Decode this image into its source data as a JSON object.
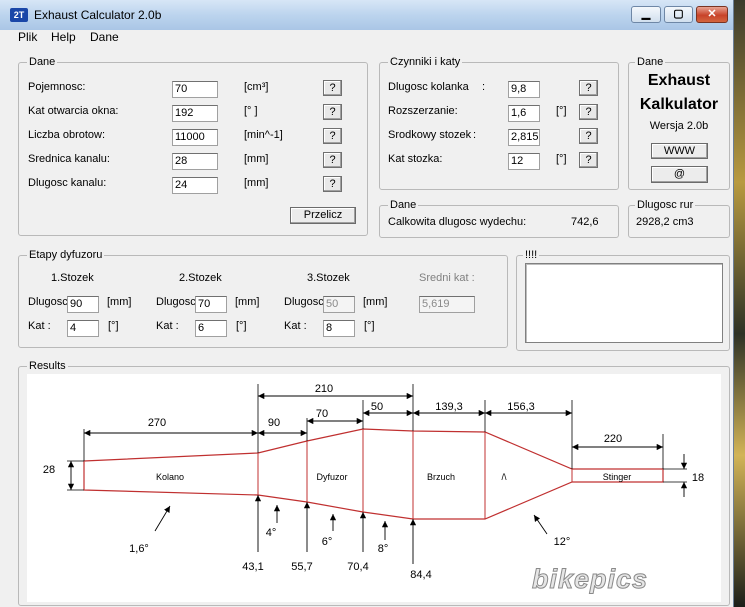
{
  "window": {
    "title": "Exhaust Calculator 2.0b",
    "icon_text": "2T",
    "controls": {
      "minimize": "▁",
      "maximize": "▢",
      "close": "✕"
    }
  },
  "menu": {
    "items": [
      "Plik",
      "Help",
      "Dane"
    ]
  },
  "dane": {
    "legend": "Dane",
    "rows": [
      {
        "label": "Pojemnosc:",
        "value": "70",
        "unit": "[cm³]",
        "help": "?"
      },
      {
        "label": "Kat otwarcia okna:",
        "value": "192",
        "unit": "[° ]",
        "help": "?"
      },
      {
        "label": "Liczba obrotow:",
        "value": "11000",
        "unit": "[min^-1]",
        "help": "?"
      },
      {
        "label": "Srednica kanalu:",
        "value": "28",
        "unit": "[mm]",
        "help": "?"
      },
      {
        "label": "Dlugosc kanalu:",
        "value": "24",
        "unit": "[mm]",
        "help": "?"
      }
    ],
    "calc_button": "Przelicz"
  },
  "czynniki": {
    "legend": "Czynniki i katy",
    "rows": [
      {
        "label": "Dlugosc kolanka",
        "sep": ":",
        "value": "9,8",
        "unit": "",
        "help": "?"
      },
      {
        "label": "Rozszerzanie:",
        "sep": "",
        "value": "1,6",
        "unit": "[°]",
        "help": "?"
      },
      {
        "label": "Srodkowy stozek",
        "sep": ":",
        "value": "2,815",
        "unit": "",
        "help": "?"
      },
      {
        "label": "Kat stozka:",
        "sep": "",
        "value": "12",
        "unit": "[°]",
        "help": "?"
      }
    ]
  },
  "about": {
    "legend": "Dane",
    "title1": "Exhaust",
    "title2": "Kalkulator",
    "version": "Wersja  2.0b",
    "www_button": "WWW",
    "mail_button": "@"
  },
  "dane2": {
    "legend": "Dane",
    "label": "Calkowita dlugosc wydechu:",
    "value": "742,6"
  },
  "dlugosc_rur": {
    "legend": "Dlugosc rur",
    "value": "2928,2 cm3"
  },
  "etapy": {
    "legend": "Etapy dyfuzoru",
    "stages": [
      {
        "title": "1.Stozek",
        "dlugosc_label": "Dlugosc",
        "dlugosc": "90",
        "dlugosc_unit": "[mm]",
        "kat_label": "Kat :",
        "kat": "4",
        "kat_unit": "[°]",
        "disabled": false
      },
      {
        "title": "2.Stozek",
        "dlugosc_label": "Dlugosc",
        "dlugosc": "70",
        "dlugosc_unit": "[mm]",
        "kat_label": "Kat :",
        "kat": "6",
        "kat_unit": "[°]",
        "disabled": false
      },
      {
        "title": "3.Stozek",
        "dlugosc_label": "Dlugosc",
        "dlugosc": "50",
        "dlugosc_unit": "[mm]",
        "kat_label": "Kat :",
        "kat": "8",
        "kat_unit": "[°]",
        "disabled": true
      }
    ],
    "sredni_label": "Sredni kat  :",
    "sredni_value": "5,619"
  },
  "notes": {
    "legend": "!!!!",
    "text": ""
  },
  "results": {
    "legend": "Results",
    "sections": [
      "Kolano",
      "Dyfuzor",
      "Brzuch",
      "/\\",
      "Stinger"
    ],
    "top_dims": [
      "270",
      "90",
      "210",
      "70",
      "50",
      "139,3",
      "156,3",
      "220"
    ],
    "left_dia": "28",
    "right_dia": "18",
    "bottom_positions": [
      "43,1",
      "55,7",
      "70,4",
      "84,4"
    ],
    "angles": [
      "1,6°",
      "4°",
      "6°",
      "8°",
      "12°"
    ],
    "line_color": "#c03030"
  },
  "watermark": "bikepics"
}
